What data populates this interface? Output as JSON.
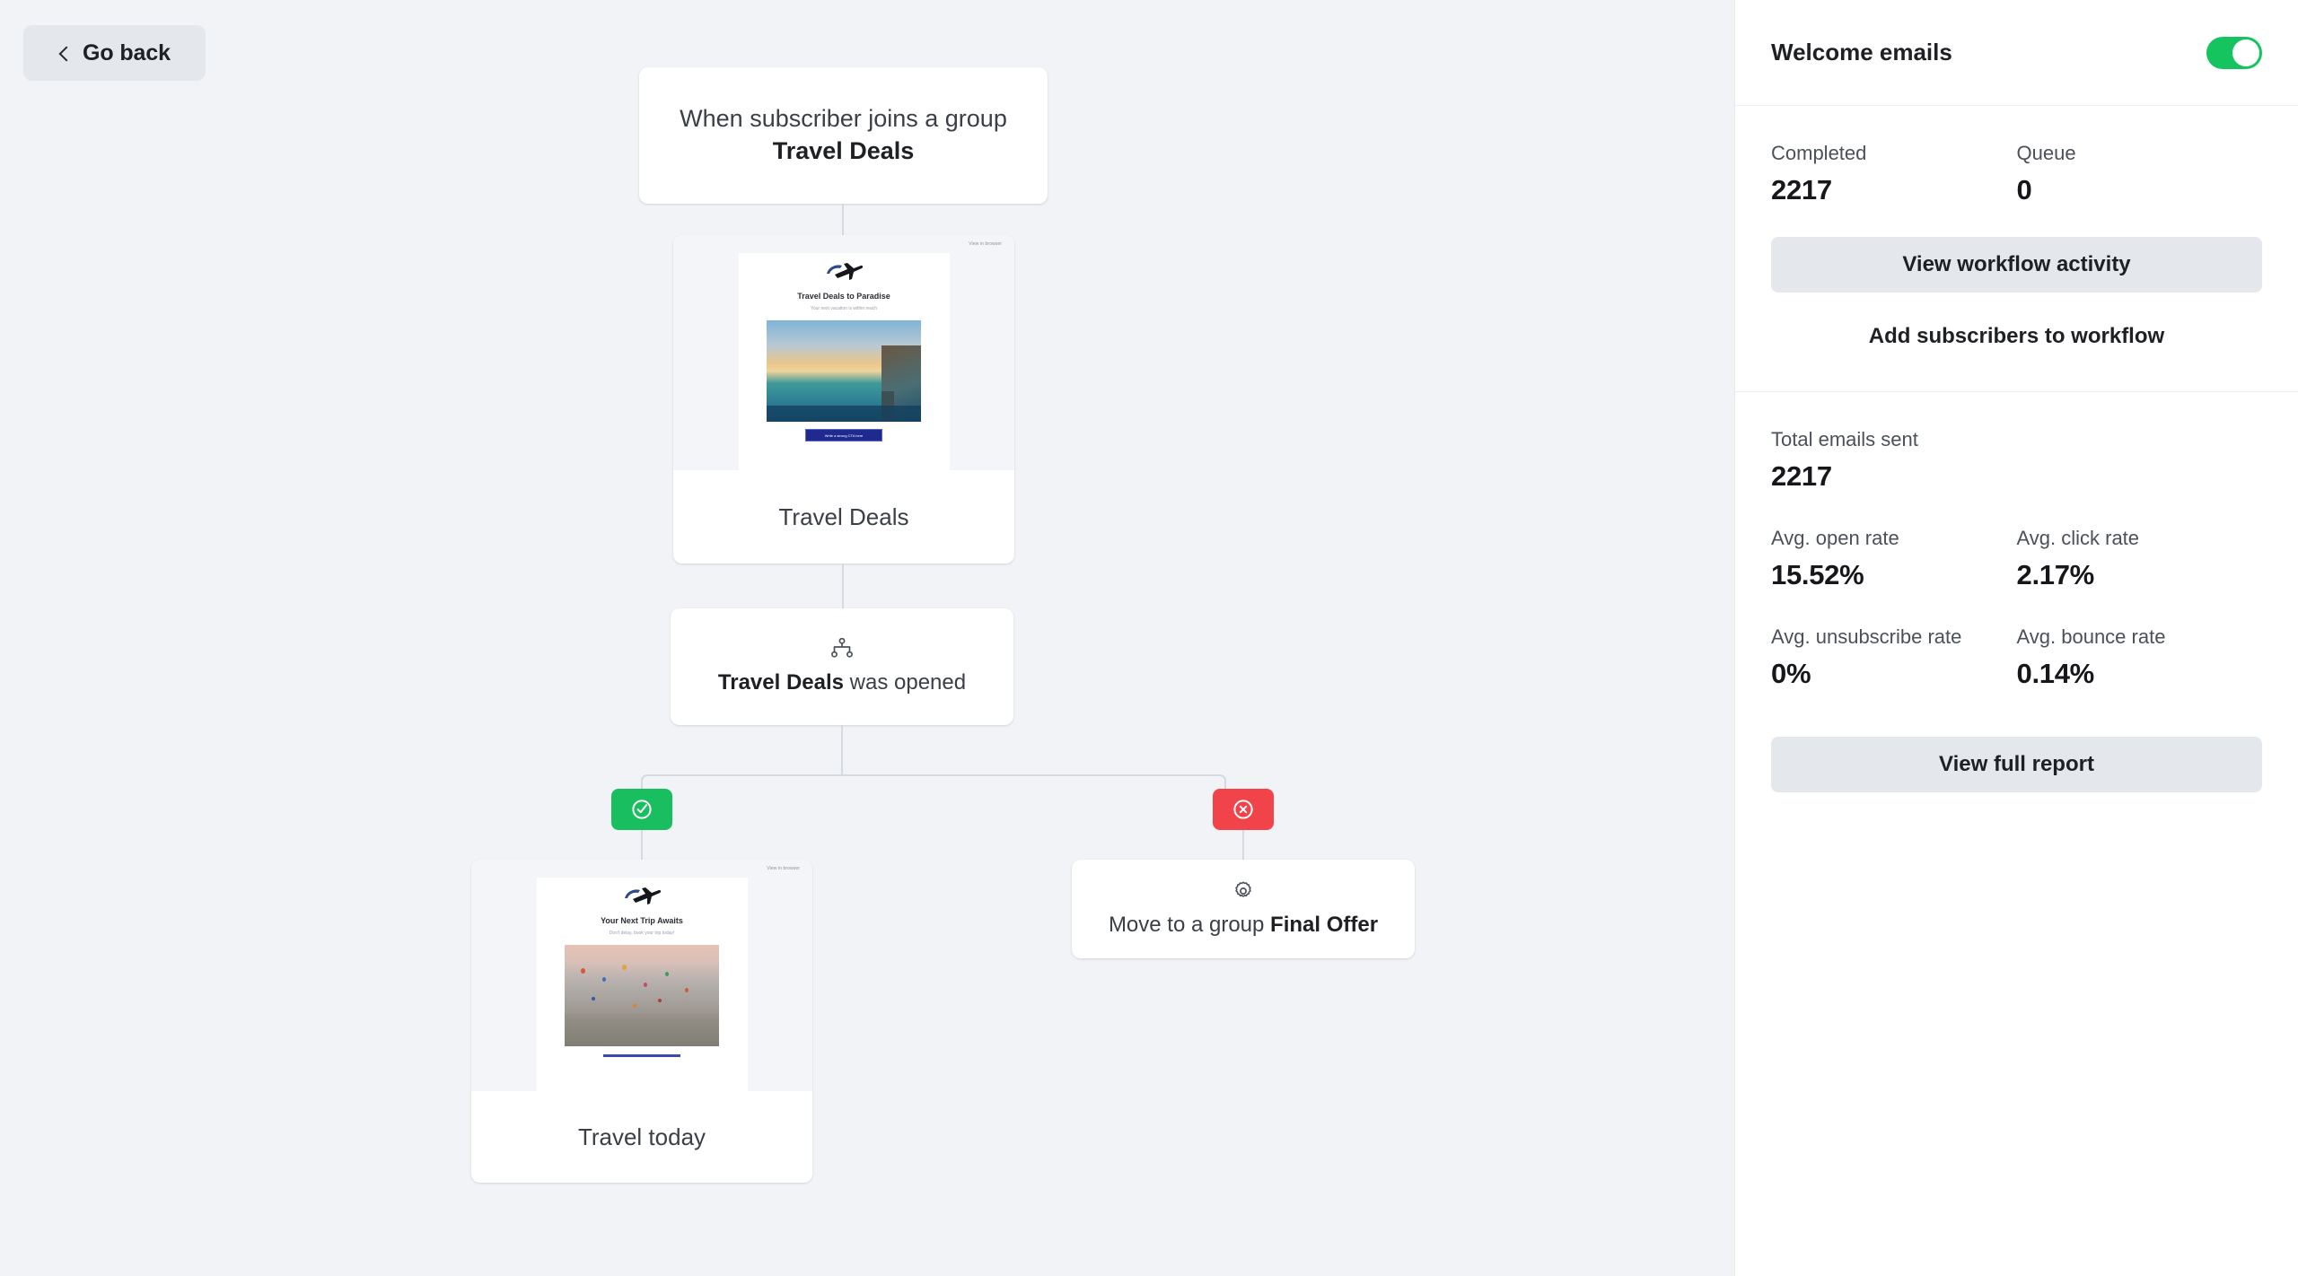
{
  "toolbar": {
    "go_back_label": "Go back",
    "back_icon": "chevron-left-icon"
  },
  "workflow": {
    "trigger": {
      "text_prefix": "When subscriber joins a group ",
      "text_bold": "Travel Deals"
    },
    "email_travel_deals": {
      "name": "Travel Deals",
      "preview_link": "View in browser",
      "headline": "Travel Deals to Paradise",
      "subheadline": "Your next vacation is within reach",
      "cta_label": "Write a strong CTA here",
      "logo_icon": "airplane-logo-icon",
      "image_alt": "overwater-bungalow-sunset-photo"
    },
    "condition": {
      "icon": "branch-split-icon",
      "text_bold": "Travel Deals",
      "text_suffix": " was opened"
    },
    "branch_yes": {
      "icon": "check-circle-icon",
      "color": "#19bf5f"
    },
    "branch_no": {
      "icon": "x-circle-icon",
      "color": "#f0444a"
    },
    "email_travel_today": {
      "name": "Travel today",
      "preview_link": "View in browser",
      "headline": "Your Next Trip Awaits",
      "subheadline": "Don't delay, book your trip today!",
      "logo_icon": "airplane-logo-icon",
      "image_alt": "hot-air-balloons-over-cappadocia-photo"
    },
    "action_move_group": {
      "icon": "gear-icon",
      "text_prefix": "Move to a group ",
      "text_bold": "Final Offer"
    }
  },
  "panel": {
    "title": "Welcome emails",
    "toggle_on": true,
    "toggle_color": "#16c45f",
    "completed_label": "Completed",
    "completed_value": "2217",
    "queue_label": "Queue",
    "queue_value": "0",
    "view_activity_label": "View workflow activity",
    "add_subscribers_label": "Add subscribers to workflow",
    "total_sent_label": "Total emails sent",
    "total_sent_value": "2217",
    "open_rate_label": "Avg. open rate",
    "open_rate_value": "15.52%",
    "click_rate_label": "Avg. click rate",
    "click_rate_value": "2.17%",
    "unsub_rate_label": "Avg. unsubscribe rate",
    "unsub_rate_value": "0%",
    "bounce_rate_label": "Avg. bounce rate",
    "bounce_rate_value": "0.14%",
    "view_report_label": "View full report"
  }
}
